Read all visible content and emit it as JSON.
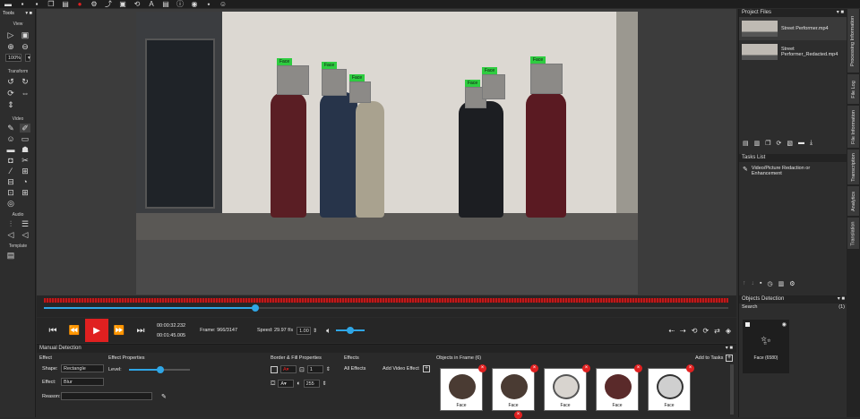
{
  "toolbar": {
    "icons": [
      "folder-icon",
      "save-icon",
      "save-all-icon",
      "copy-icon",
      "paste-icon",
      "record-icon",
      "settings-icon",
      "share-icon",
      "lock-icon",
      "transform-icon",
      "text-icon",
      "note-icon",
      "info-icon",
      "web-icon",
      "link-icon",
      "user-icon"
    ]
  },
  "tools": {
    "title": "Tools",
    "sections": {
      "view": "View",
      "transform": "Transform",
      "video": "Video",
      "audio": "Audio",
      "template": "Template"
    },
    "zoom": "100%"
  },
  "video": {
    "detections": [
      {
        "label": "Face"
      },
      {
        "label": "Face"
      },
      {
        "label": "Face"
      },
      {
        "label": "Face"
      },
      {
        "label": "Face"
      },
      {
        "label": "Face"
      }
    ]
  },
  "controls": {
    "time_current": "00:00:32.232",
    "time_total": "00:01:45.005",
    "frame": "Frame: 966/3147",
    "speed": "Speed: 29.97 f/s",
    "rate": "1.00"
  },
  "manual_detection": {
    "title": "Manual Detection",
    "effect_label": "Effect",
    "shape_label": "Shape:",
    "shape_value": "Rectangle",
    "effect_field_label": "Effect:",
    "effect_value": "Blur",
    "reason_label": "Reason:",
    "effect_props_label": "Effect Properties",
    "level_label": "Level:",
    "border_label": "Border & Fill Properties",
    "border_width": "1",
    "fill_opacity": "255",
    "effects_label": "Effects",
    "all_effects": "All Effects",
    "add_video_effect": "Add Video Effect",
    "objects_label": "Objects in Frame (6)",
    "add_to_tasks": "Add to Tasks",
    "objects": [
      "Face",
      "Face",
      "Face",
      "Face",
      "Face"
    ]
  },
  "project_files": {
    "title": "Project Files",
    "files": [
      "Street Performer.mp4",
      "Street Performer_Redacted.mp4"
    ]
  },
  "tasks": {
    "title": "Tasks List",
    "items": [
      "Video/Picture Redaction or Enhancement"
    ]
  },
  "objects_detection": {
    "title": "Objects Detection",
    "search_label": "Search",
    "count": "(1)",
    "item_label": "Face (6580)"
  },
  "side_tabs": [
    "Processing Information",
    "File Log",
    "File Information",
    "Transcription",
    "Analytics",
    "Translation"
  ],
  "colors": {
    "accent": "#2fa6e6",
    "danger": "#e02020",
    "label_green": "#2ecc40",
    "wave_red": "#c0191a"
  }
}
